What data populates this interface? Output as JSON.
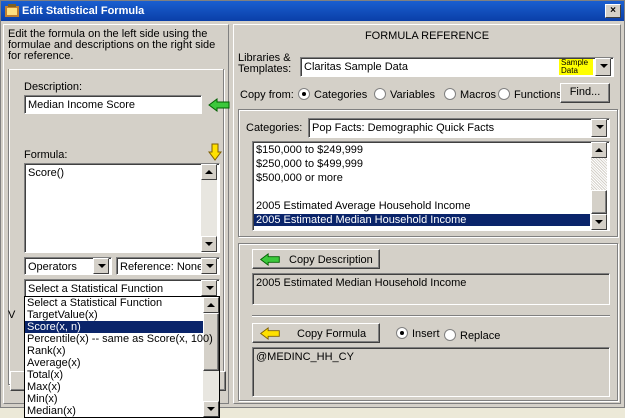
{
  "window": {
    "title": "Edit Statistical Formula",
    "close": "×"
  },
  "left": {
    "instructions": "Edit the formula on the left side using the formulae and descriptions on the right side for reference.",
    "description_label": "Description:",
    "description_value": "Median Income Score",
    "formula_label": "Formula:",
    "formula_value": "Score()",
    "operators_label": "Operators",
    "reference_label": "Reference: None",
    "stat_select_value": "Select a Statistical Function",
    "stat_options": [
      "Select a Statistical Function",
      "TargetValue(x)",
      "Score(x, n)",
      "Percentile(x)  -- same as Score(x, 100)",
      "Rank(x)",
      "Average(x)",
      "Total(x)",
      "Max(x)",
      "Min(x)",
      "Median(x)"
    ],
    "stat_selected_index": 2,
    "behind_letter": "V"
  },
  "right": {
    "heading": "FORMULA REFERENCE",
    "libraries_label_1": "Libraries &",
    "libraries_label_2": "Templates:",
    "library_value": "Claritas Sample Data",
    "sample_badge_1": "Sample",
    "sample_badge_2": "Data",
    "copy_from_label": "Copy from:",
    "copy_from_options": [
      "Categories",
      "Variables",
      "Macros",
      "Functions"
    ],
    "copy_from_selected": 0,
    "find_label": "Find...",
    "categories_label": "Categories:",
    "categories_value": "Pop Facts: Demographic Quick Facts",
    "variables": [
      "$150,000 to $249,999",
      "$250,000 to $499,999",
      "$500,000 or more",
      "",
      "2005 Estimated Average Household Income",
      "2005 Estimated Median Household Income"
    ],
    "variables_selected_index": 5,
    "copy_description_label": "Copy Description",
    "description_text": "2005 Estimated Median Household Income",
    "copy_formula_label": "Copy Formula",
    "insert_label": "Insert",
    "replace_label": "Replace",
    "formula_text": "@MEDINC_HH_CY"
  },
  "colors": {
    "arrow_green": "#3cc83c",
    "arrow_yellow": "#ffe000",
    "selection": "#0a246a",
    "title_bar": "#0a3fa8",
    "badge": "#ffff00"
  }
}
